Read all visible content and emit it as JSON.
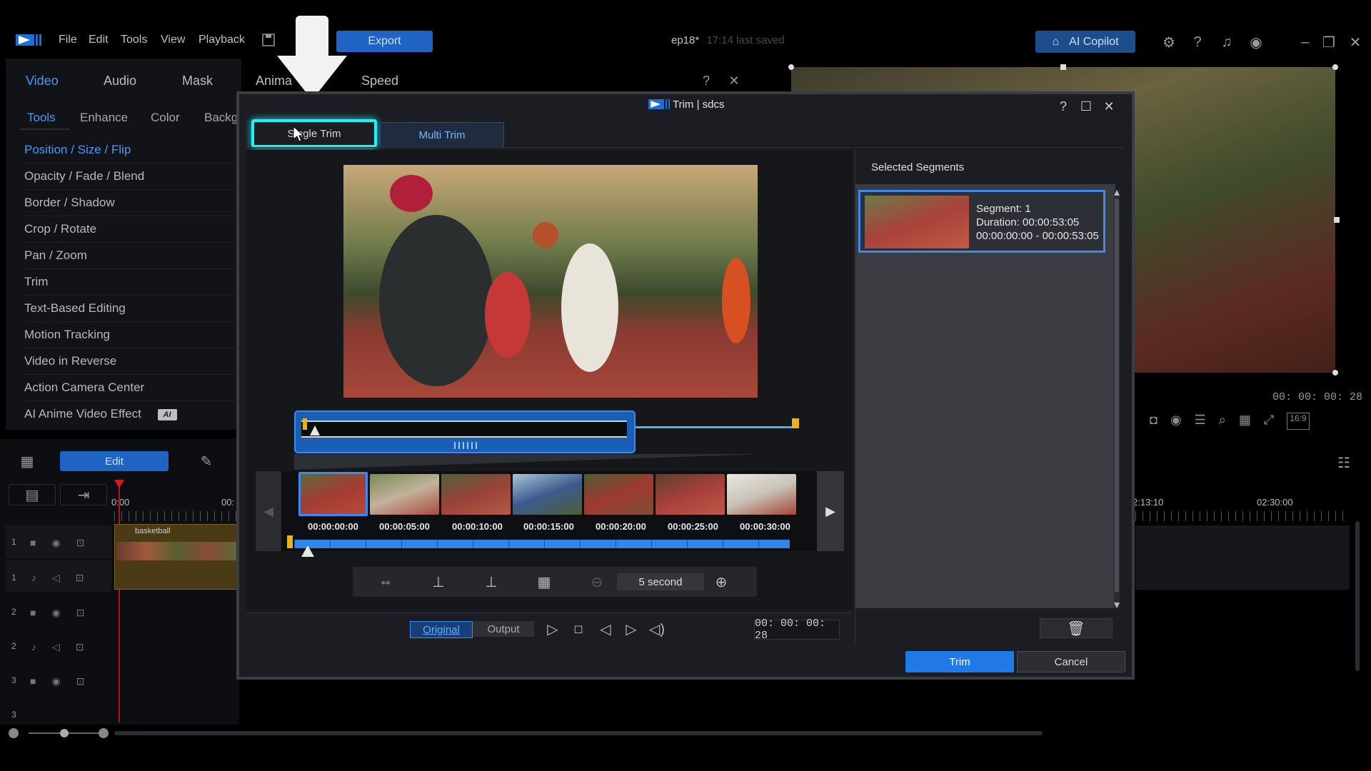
{
  "menu": [
    "File",
    "Edit",
    "Tools",
    "View",
    "Playback"
  ],
  "export_label": "Export",
  "project_title": "ep18*",
  "saved_status": "17:14 last saved",
  "ai_copilot_label": "AI Copilot",
  "left_tabs": [
    "Video",
    "Audio",
    "Mask",
    "Anima",
    "Speed"
  ],
  "sub_tabs": [
    "Tools",
    "Enhance",
    "Color",
    "Backg"
  ],
  "tools": [
    "Position / Size / Flip",
    "Opacity / Fade / Blend",
    "Border / Shadow",
    "Crop / Rotate",
    "Pan / Zoom",
    "Trim",
    "Text-Based Editing",
    "Motion Tracking",
    "Video in Reverse",
    "Action Camera Center",
    "AI Anime Video Effect"
  ],
  "ai_badge": "AI",
  "timeline": {
    "edit_label": "Edit",
    "time_zero": "0:00",
    "time_partial": "00:",
    "clip_name": "basketball",
    "tracks": [
      "1",
      "1",
      "2",
      "2",
      "3",
      "3"
    ],
    "ruler_right": [
      "2:13:10",
      "02:30:00"
    ]
  },
  "preview": {
    "timecode": "00: 00: 00: 28",
    "aspect": "16:9"
  },
  "dialog": {
    "title": "Trim | sdcs",
    "tab_single": "Single Trim",
    "tab_multi": "Multi Trim",
    "selected_segments_title": "Selected Segments",
    "segment": {
      "name": "Segment: 1",
      "duration": "Duration: 00:00:53:05",
      "range": "00:00:00:00 - 00:00:53:05"
    },
    "thumb_times": [
      "00:00:00:00",
      "00:00:05:00",
      "00:00:10:00",
      "00:00:15:00",
      "00:00:20:00",
      "00:00:25:00",
      "00:00:30:00"
    ],
    "zoom_label": "5 second",
    "original_label": "Original",
    "output_label": "Output",
    "timecode": "00: 00: 00: 28",
    "trim_label": "Trim",
    "cancel_label": "Cancel"
  },
  "colors": {
    "accent": "#1f7ae8",
    "highlight": "#18e0f0",
    "marker": "#e8b21a"
  }
}
